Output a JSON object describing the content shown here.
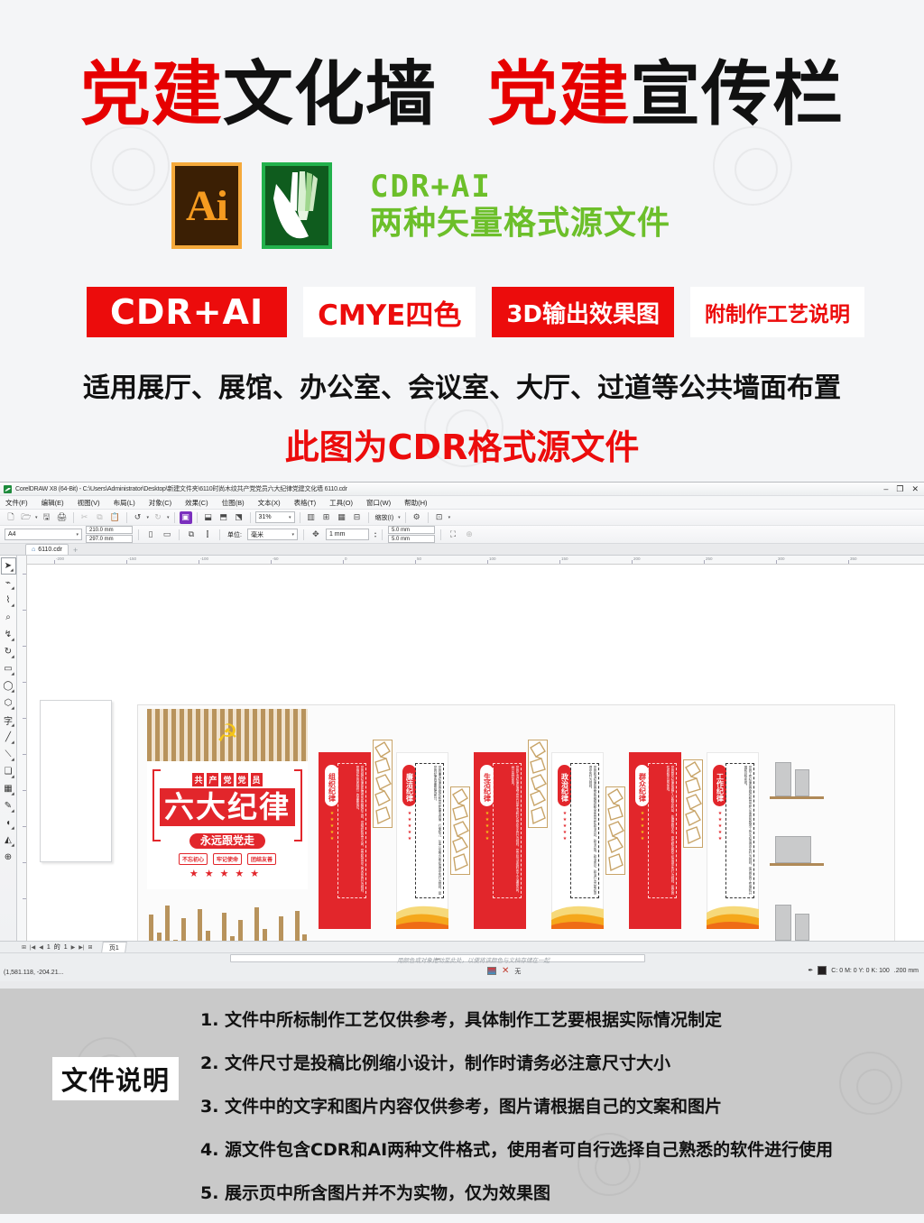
{
  "promo": {
    "title_parts": [
      {
        "text": "党建",
        "color": "red"
      },
      {
        "text": "文化墙",
        "color": "black"
      },
      {
        "text": "  ",
        "color": "black"
      },
      {
        "text": "党建",
        "color": "red"
      },
      {
        "text": "宣传栏",
        "color": "black"
      }
    ],
    "title_plain": "党建文化墙 党建宣传栏",
    "ai_logo_label": "Ai",
    "cdr_logo_label": "CorelDRAW",
    "logo_text_line1": "CDR+AI",
    "logo_text_line2": "两种矢量格式源文件",
    "badges": [
      {
        "label": "CDR+AI",
        "style": "solid"
      },
      {
        "label": "CMYE四色",
        "style": "hollow"
      },
      {
        "label": "3D输出效果图",
        "style": "solid"
      },
      {
        "label": "附制作工艺说明",
        "style": "hollow"
      }
    ],
    "subtitle": "适用展厅、展馆、办公室、会议室、大厅、过道等公共墙面布置",
    "subtitle2": "此图为CDR格式源文件",
    "accent_red": "#ec0c0c",
    "accent_green": "#6cbf2a"
  },
  "app": {
    "title": "CorelDRAW X8 (64-Bit) - C:\\Users\\Administrator\\Desktop\\新建文件夹\\6110时尚木纹共产党党员六大纪律党建文化墙 6110.cdr",
    "window_controls": [
      "–",
      "❐",
      "✕"
    ],
    "menus": [
      "文件(F)",
      "编辑(E)",
      "视图(V)",
      "布局(L)",
      "对象(C)",
      "效果(C)",
      "位图(B)",
      "文本(X)",
      "表格(T)",
      "工具(O)",
      "窗口(W)",
      "帮助(H)"
    ],
    "toolbar": {
      "zoom_level": "31%",
      "preset_label": "缩放(I)",
      "page_preset": "A4",
      "page_width": "210.0 mm",
      "page_height": "297.0 mm",
      "units_label": "单位:",
      "units_value": "毫米",
      "nudge": "1 mm",
      "duplicate_x": "5.0 mm",
      "duplicate_y": "5.0 mm"
    },
    "document_tab": "6110.cdr",
    "new_tab_label": "+",
    "toolbox": [
      {
        "name": "pick-tool",
        "glyph": "➤"
      },
      {
        "name": "shape-tool",
        "glyph": "⌁"
      },
      {
        "name": "smear-tool",
        "glyph": "⌇"
      },
      {
        "name": "zoom-tool",
        "glyph": "⌕"
      },
      {
        "name": "freehand-tool",
        "glyph": "↯"
      },
      {
        "name": "artistic-media-tool",
        "glyph": "↻"
      },
      {
        "name": "rectangle-tool",
        "glyph": "▭"
      },
      {
        "name": "ellipse-tool",
        "glyph": "◯"
      },
      {
        "name": "polygon-tool",
        "glyph": "⬡"
      },
      {
        "name": "text-tool",
        "glyph": "字"
      },
      {
        "name": "parallel-dimension-tool",
        "glyph": "╱"
      },
      {
        "name": "connector-tool",
        "glyph": "⟍"
      },
      {
        "name": "drop-shadow-tool",
        "glyph": "❏"
      },
      {
        "name": "transparency-tool",
        "glyph": "▦"
      },
      {
        "name": "color-eyedropper-tool",
        "glyph": "✎"
      },
      {
        "name": "interactive-fill-tool",
        "glyph": "◖"
      },
      {
        "name": "smart-fill-tool",
        "glyph": "◭"
      },
      {
        "name": "add-tool",
        "glyph": "⊕"
      }
    ],
    "page_nav": {
      "current": "1",
      "of_label": "的",
      "total": "1",
      "tab": "页1"
    },
    "status": {
      "hint": "用颜色或对象拖动至此处，以便将该颜色与文档存储在一起",
      "coords": "(1,581.118, -204.21...",
      "fill_none": "无",
      "outline_color": "C: 0 M: 0 Y: 0 K: 100",
      "outline_width": ".200 mm"
    }
  },
  "artwork": {
    "emblem": "☭",
    "tag_chars": [
      "共",
      "产",
      "党",
      "党",
      "员"
    ],
    "big_title": "六大纪律",
    "pill": "永远跟党走",
    "mini_tags": [
      "不忘初心",
      "牢记使命",
      "团结友善"
    ],
    "stars": "★★★★★",
    "disciplines": [
      {
        "label": "组织纪律",
        "style": "red",
        "body": "党的组织纪律是处理党的各级组织之间、党组织和党员之间、党员和党员之间关系的行为规则，是维护党的团结统一的重要保证。"
      },
      {
        "label": "廉洁纪律",
        "style": "white",
        "body": "党的廉洁纪律是党组织和党员在廉洁自律、行使权力、从事公务等方面必须遵守的行为规则，是党的纪律的重要组成部分。"
      },
      {
        "label": "生活纪律",
        "style": "red",
        "body": "党的生活纪律是调节党员日常生活和社会交往中的行为规则，党员应当发扬社会主义道德风尚，树立良好家风。"
      },
      {
        "label": "政治纪律",
        "style": "white",
        "body": "党的政治纪律是党的各级组织和全体党员在政治方向、政治立场、政治言论、政治行为方面必须遵守的行为规则。"
      },
      {
        "label": "群众纪律",
        "style": "red",
        "body": "党的群众纪律是维护人民群众利益、处理党群关系、密切联系群众必须遵守的行为规则，是党的性质和宗旨的体现。"
      },
      {
        "label": "工作纪律",
        "style": "white",
        "body": "党的工作纪律是党组织和党员在从事党的各项工作中必须遵守的行为规则，保证党的工作顺利开展和目标实现。"
      }
    ]
  },
  "notes": {
    "badge": "文件说明",
    "items": [
      "1. 文件中所标制作工艺仅供参考，具体制作工艺要根据实际情况制定",
      "2. 文件尺寸是投稿比例缩小设计，制作时请务必注意尺寸大小",
      "3. 文件中的文字和图片内容仅供参考，图片请根据自己的文案和图片",
      "4. 源文件包含CDR和AI两种文件格式，使用者可自行选择自己熟悉的软件进行使用",
      "5. 展示页中所含图片并不为实物，仅为效果图"
    ]
  }
}
